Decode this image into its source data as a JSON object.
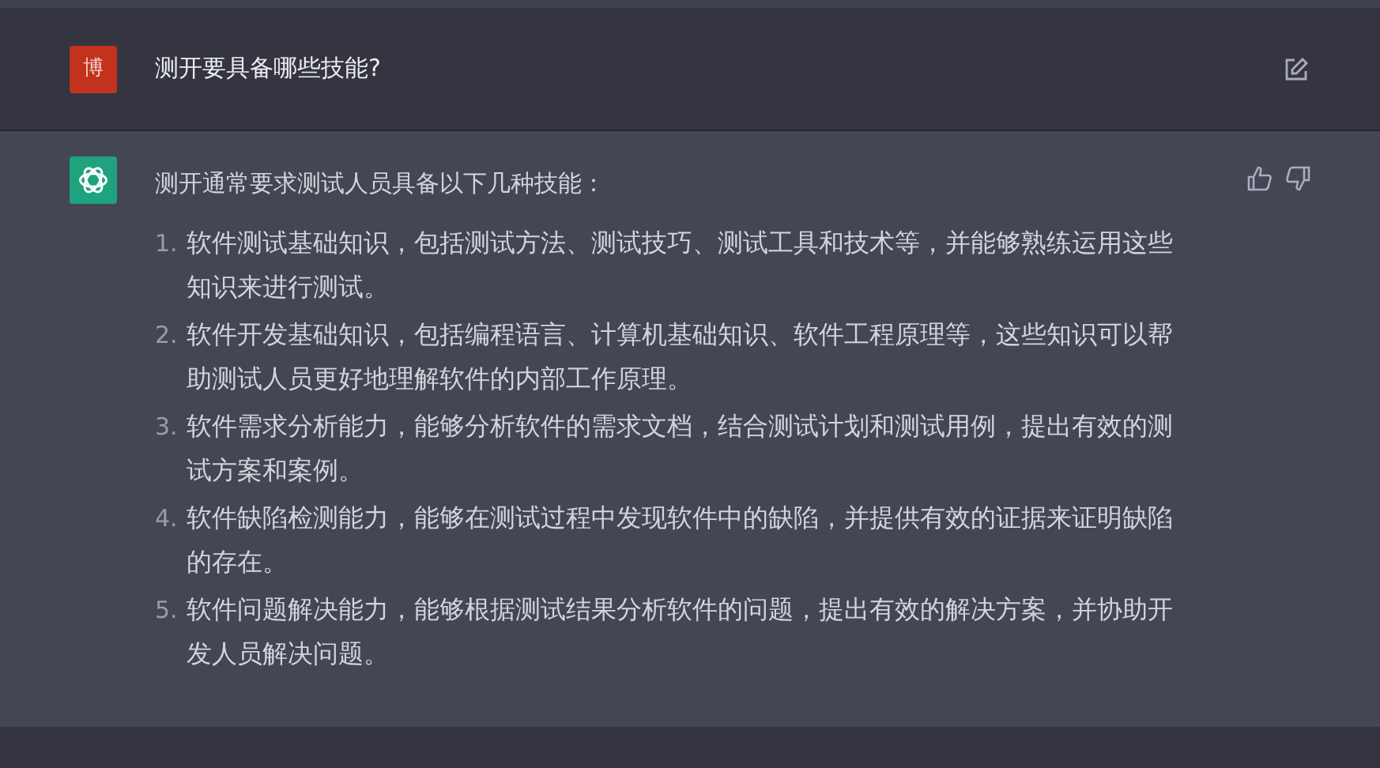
{
  "question": {
    "avatar": "博",
    "text": "测开要具备哪些技能?"
  },
  "answer": {
    "intro": "测开通常要求测试人员具备以下几种技能：",
    "items": [
      {
        "number": "1.",
        "text": "软件测试基础知识，包括测试方法、测试技巧、测试工具和技术等，并能够熟练运用这些知识来进行测试。"
      },
      {
        "number": "2.",
        "text": "软件开发基础知识，包括编程语言、计算机基础知识、软件工程原理等，这些知识可以帮助测试人员更好地理解软件的内部工作原理。"
      },
      {
        "number": "3.",
        "text": "软件需求分析能力，能够分析软件的需求文档，结合测试计划和测试用例，提出有效的测试方案和案例。"
      },
      {
        "number": "4.",
        "text": "软件缺陷检测能力，能够在测试过程中发现软件中的缺陷，并提供有效的证据来证明缺陷的存在。"
      },
      {
        "number": "5.",
        "text": "软件问题解决能力，能够根据测试结果分析软件的问题，提出有效的解决方案，并协助开发人员解决问题。"
      }
    ]
  }
}
